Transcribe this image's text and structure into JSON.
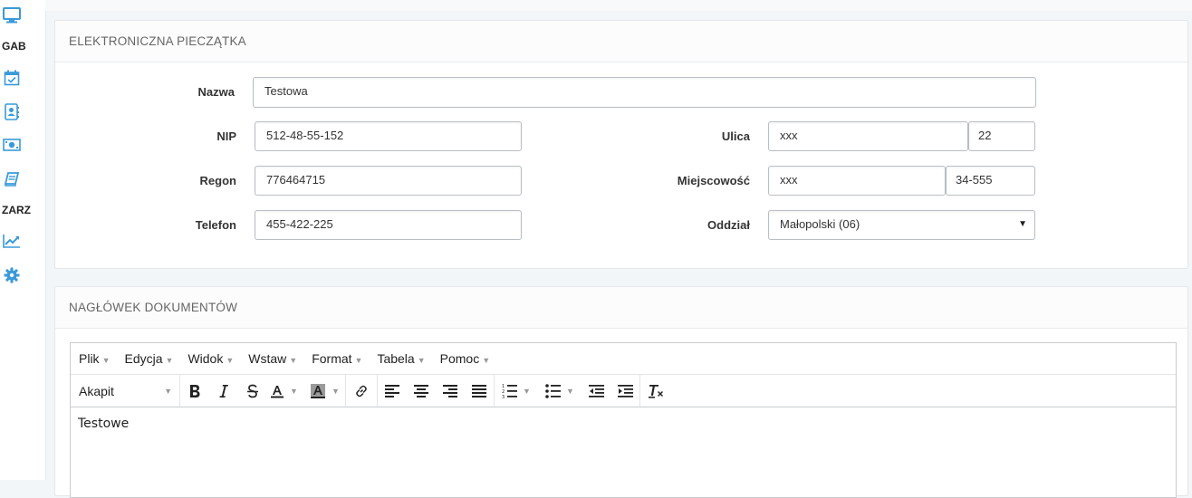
{
  "sidebar": {
    "items": [
      {
        "icon": "monitor-icon"
      },
      {
        "label": "GAB"
      },
      {
        "icon": "calendar-check-icon"
      },
      {
        "icon": "contact-book-icon"
      },
      {
        "icon": "money-icon"
      },
      {
        "icon": "book-icon"
      },
      {
        "label": "ZARZ"
      },
      {
        "icon": "chart-line-icon"
      },
      {
        "icon": "gear-icon"
      }
    ],
    "accent_color": "#3a9ad9"
  },
  "stamp_panel": {
    "title": "ELEKTRONICZNA PIECZĄTKA",
    "nazwa": {
      "label": "Nazwa",
      "value": "Testowa"
    },
    "nip": {
      "label": "NIP",
      "value": "512-48-55-152"
    },
    "regon": {
      "label": "Regon",
      "value": "776464715"
    },
    "telefon": {
      "label": "Telefon",
      "value": "455-422-225"
    },
    "ulica": {
      "label": "Ulica",
      "value": "xxx",
      "number": "22"
    },
    "miejscowosc": {
      "label": "Miejscowość",
      "value": "xxx",
      "postcode": "34-555"
    },
    "oddzial": {
      "label": "Oddział",
      "value": "Małopolski (06)"
    }
  },
  "header_panel": {
    "title": "NAGŁÓWEK DOKUMENTÓW",
    "menu": [
      "Plik",
      "Edycja",
      "Widok",
      "Wstaw",
      "Format",
      "Tabela",
      "Pomoc"
    ],
    "format_select": "Akapit",
    "content": "Testowe"
  }
}
